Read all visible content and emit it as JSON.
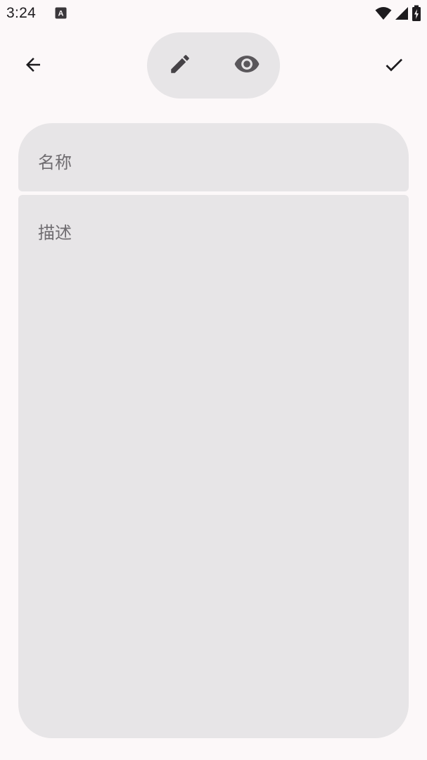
{
  "status_bar": {
    "time": "3:24",
    "app_icon": "text-a-icon",
    "indicators": [
      "wifi-icon",
      "cell-signal-icon",
      "battery-charging-icon"
    ]
  },
  "toolbar": {
    "back_icon": "arrow-back-icon",
    "edit_icon": "pencil-icon",
    "preview_icon": "eye-icon",
    "confirm_icon": "check-icon"
  },
  "form": {
    "name_placeholder": "名称",
    "description_placeholder": "描述"
  },
  "colors": {
    "background": "#fcf8f9",
    "field_background": "#e7e5e7",
    "icon": "#1d1b1e",
    "placeholder": "#6f6c70"
  }
}
